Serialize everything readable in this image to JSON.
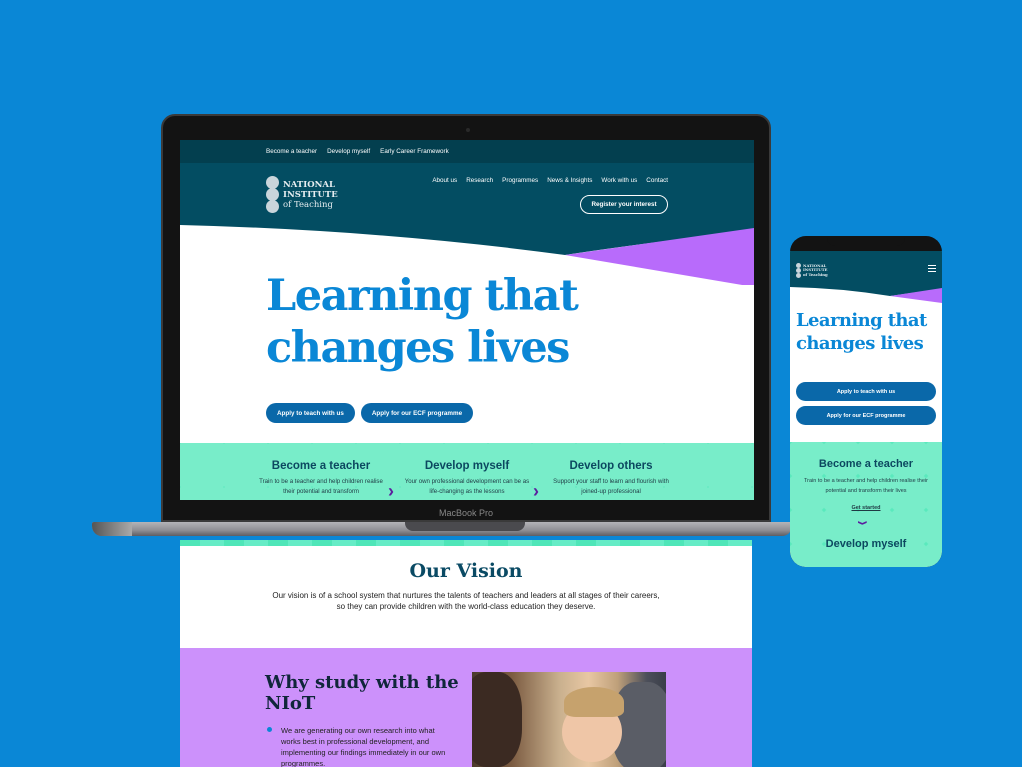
{
  "site": {
    "logo_lines": [
      "NATIONAL",
      "INSTITUTE",
      "of Teaching"
    ],
    "top_links": [
      "Become a teacher",
      "Develop myself",
      "Early Career Framework"
    ],
    "nav_links": [
      "About us",
      "Research",
      "Programmes",
      "News & Insights",
      "Work with us",
      "Contact"
    ],
    "register_label": "Register your interest",
    "hero": {
      "title_line1": "Learning that",
      "title_line2": "changes lives",
      "btn_teach": "Apply to teach with us",
      "btn_ecf": "Apply for our ECF programme"
    },
    "cards": [
      {
        "title": "Become a teacher",
        "text": "Train to be a teacher and help children realise their potential and transform"
      },
      {
        "title": "Develop myself",
        "text": "Your own professional development can be as life-changing as the lessons"
      },
      {
        "title": "Develop others",
        "text": "Support your staff to learn and flourish with joined-up professional"
      }
    ],
    "vision": {
      "title": "Our Vision",
      "line1": "Our vision is of a school system that nurtures the talents of teachers and leaders at all stages of their careers,",
      "line2": "so they can provide children with the world-class education they deserve."
    },
    "why": {
      "title": "Why study with the NIoT",
      "bullet1": "We are generating our own research into what works best in professional development, and implementing our findings immediately in our own programmes."
    }
  },
  "device": {
    "laptop_label": "MacBook Pro"
  },
  "mobile": {
    "card_title": "Become a teacher",
    "card_text": "Train to be a teacher and help children realise their potential and transform their lives",
    "card_link": "Get started",
    "next_title": "Develop myself"
  },
  "colors": {
    "background": "#0a87d6",
    "navy": "#034d62",
    "hero_blue": "#0a87d6",
    "purple": "#b86bfb",
    "mint": "#5ae9bd",
    "lilac": "#cc91fb"
  }
}
